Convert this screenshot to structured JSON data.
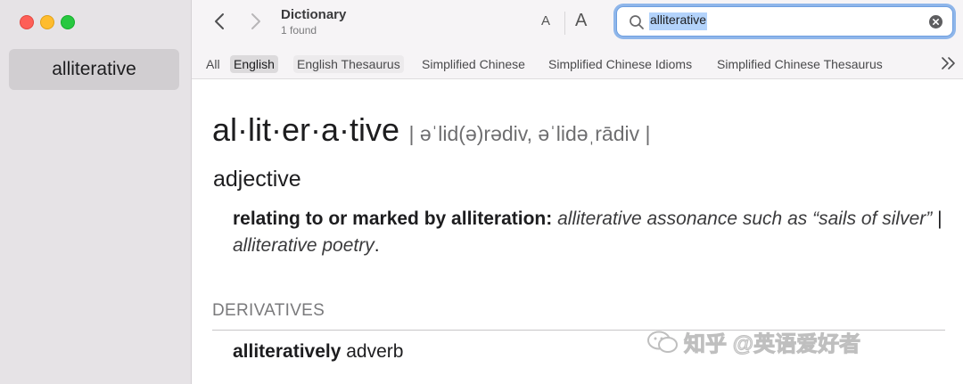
{
  "sidebar": {
    "items": [
      {
        "label": "alliterative"
      }
    ]
  },
  "toolbar": {
    "title": "Dictionary",
    "subtitle": "1 found",
    "font_small_label": "A",
    "font_large_label": "A",
    "search_value": "alliterative"
  },
  "tabs": [
    {
      "label": "All"
    },
    {
      "label": "English"
    },
    {
      "label": "English Thesaurus"
    },
    {
      "label": "Simplified Chinese"
    },
    {
      "label": "Simplified Chinese Idioms"
    },
    {
      "label": "Simplified Chinese Thesaurus"
    }
  ],
  "entry": {
    "headword": "al·lit·er·a·tive",
    "pronunciation": "| əˈlid(ə)rədiv, əˈlidəˌrādiv |",
    "part_of_speech": "adjective",
    "definition": "relating to or marked by alliteration:",
    "example_1": "alliterative assonance such as “sails of silver”",
    "example_sep": "|",
    "example_2": "alliterative poetry",
    "example_end": ".",
    "derivatives_heading": "DERIVATIVES",
    "derivative_word": "alliteratively",
    "derivative_pos": "adverb"
  },
  "watermark": {
    "text": "知乎 @英语爱好者"
  },
  "colors": {
    "accent": "#6e9fe0",
    "selection": "#b3d3fb",
    "sidebar_bg": "#e6e3e6"
  }
}
